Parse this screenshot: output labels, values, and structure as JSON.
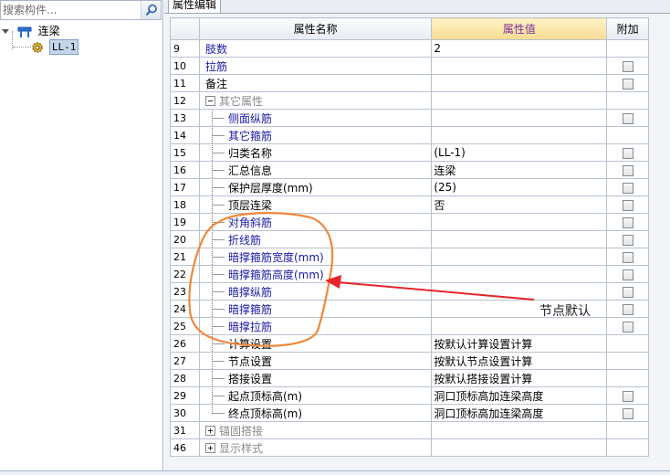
{
  "search": {
    "placeholder": "搜索构件..."
  },
  "tree": {
    "root_label": "连梁",
    "child_label": "LL-1"
  },
  "tab": {
    "label": "属性编辑"
  },
  "grid": {
    "headers": {
      "name": "属性名称",
      "value": "属性值",
      "extra": "附加"
    },
    "rows": [
      {
        "num": "9",
        "name": "肢数",
        "value": "2",
        "check": false,
        "style": "blue",
        "indent": "top"
      },
      {
        "num": "10",
        "name": "拉筋",
        "value": "",
        "check": true,
        "style": "blue",
        "indent": "top"
      },
      {
        "num": "11",
        "name": "备注",
        "value": "",
        "check": true,
        "style": "black",
        "indent": "top"
      },
      {
        "num": "12",
        "name": "其它属性",
        "value": "",
        "check": false,
        "style": "gray",
        "indent": "group-open"
      },
      {
        "num": "13",
        "name": "侧面纵筋",
        "value": "",
        "check": true,
        "style": "blue",
        "indent": "child"
      },
      {
        "num": "14",
        "name": "其它箍筋",
        "value": "",
        "check": false,
        "style": "blue",
        "indent": "child"
      },
      {
        "num": "15",
        "name": "归类名称",
        "value": "(LL-1)",
        "check": true,
        "style": "black",
        "indent": "child"
      },
      {
        "num": "16",
        "name": "汇总信息",
        "value": "连梁",
        "check": true,
        "style": "black",
        "indent": "child"
      },
      {
        "num": "17",
        "name": "保护层厚度(mm)",
        "value": "(25)",
        "check": true,
        "style": "black",
        "indent": "child"
      },
      {
        "num": "18",
        "name": "顶层连梁",
        "value": "否",
        "check": true,
        "style": "black",
        "indent": "child"
      },
      {
        "num": "19",
        "name": "对角斜筋",
        "value": "",
        "check": true,
        "style": "blue",
        "indent": "child"
      },
      {
        "num": "20",
        "name": "折线筋",
        "value": "",
        "check": true,
        "style": "blue",
        "indent": "child"
      },
      {
        "num": "21",
        "name": "暗撑箍筋宽度(mm)",
        "value": "",
        "check": true,
        "style": "blue",
        "indent": "child"
      },
      {
        "num": "22",
        "name": "暗撑箍筋高度(mm)",
        "value": "",
        "check": true,
        "style": "blue",
        "indent": "child"
      },
      {
        "num": "23",
        "name": "暗撑纵筋",
        "value": "",
        "check": true,
        "style": "blue",
        "indent": "child"
      },
      {
        "num": "24",
        "name": "暗撑箍筋",
        "value": "",
        "check": true,
        "style": "blue",
        "indent": "child"
      },
      {
        "num": "25",
        "name": "暗撑拉筋",
        "value": "",
        "check": true,
        "style": "blue",
        "indent": "child"
      },
      {
        "num": "26",
        "name": "计算设置",
        "value": "按默认计算设置计算",
        "check": false,
        "style": "black",
        "indent": "child"
      },
      {
        "num": "27",
        "name": "节点设置",
        "value": "按默认节点设置计算",
        "check": false,
        "style": "black",
        "indent": "child"
      },
      {
        "num": "28",
        "name": "搭接设置",
        "value": "按默认搭接设置计算",
        "check": false,
        "style": "black",
        "indent": "child"
      },
      {
        "num": "29",
        "name": "起点顶标高(m)",
        "value": "洞口顶标高加连梁高度",
        "check": true,
        "style": "black",
        "indent": "child"
      },
      {
        "num": "30",
        "name": "终点顶标高(m)",
        "value": "洞口顶标高加连梁高度",
        "check": true,
        "style": "black",
        "indent": "last"
      },
      {
        "num": "31",
        "name": "锚固搭接",
        "value": "",
        "check": false,
        "style": "gray",
        "indent": "group-closed"
      },
      {
        "num": "46",
        "name": "显示样式",
        "value": "",
        "check": false,
        "style": "gray",
        "indent": "group-closed"
      }
    ]
  },
  "annotation": {
    "text": "节点默认",
    "circle_color": "#f0883c",
    "arrow_color": "#e8242a"
  }
}
